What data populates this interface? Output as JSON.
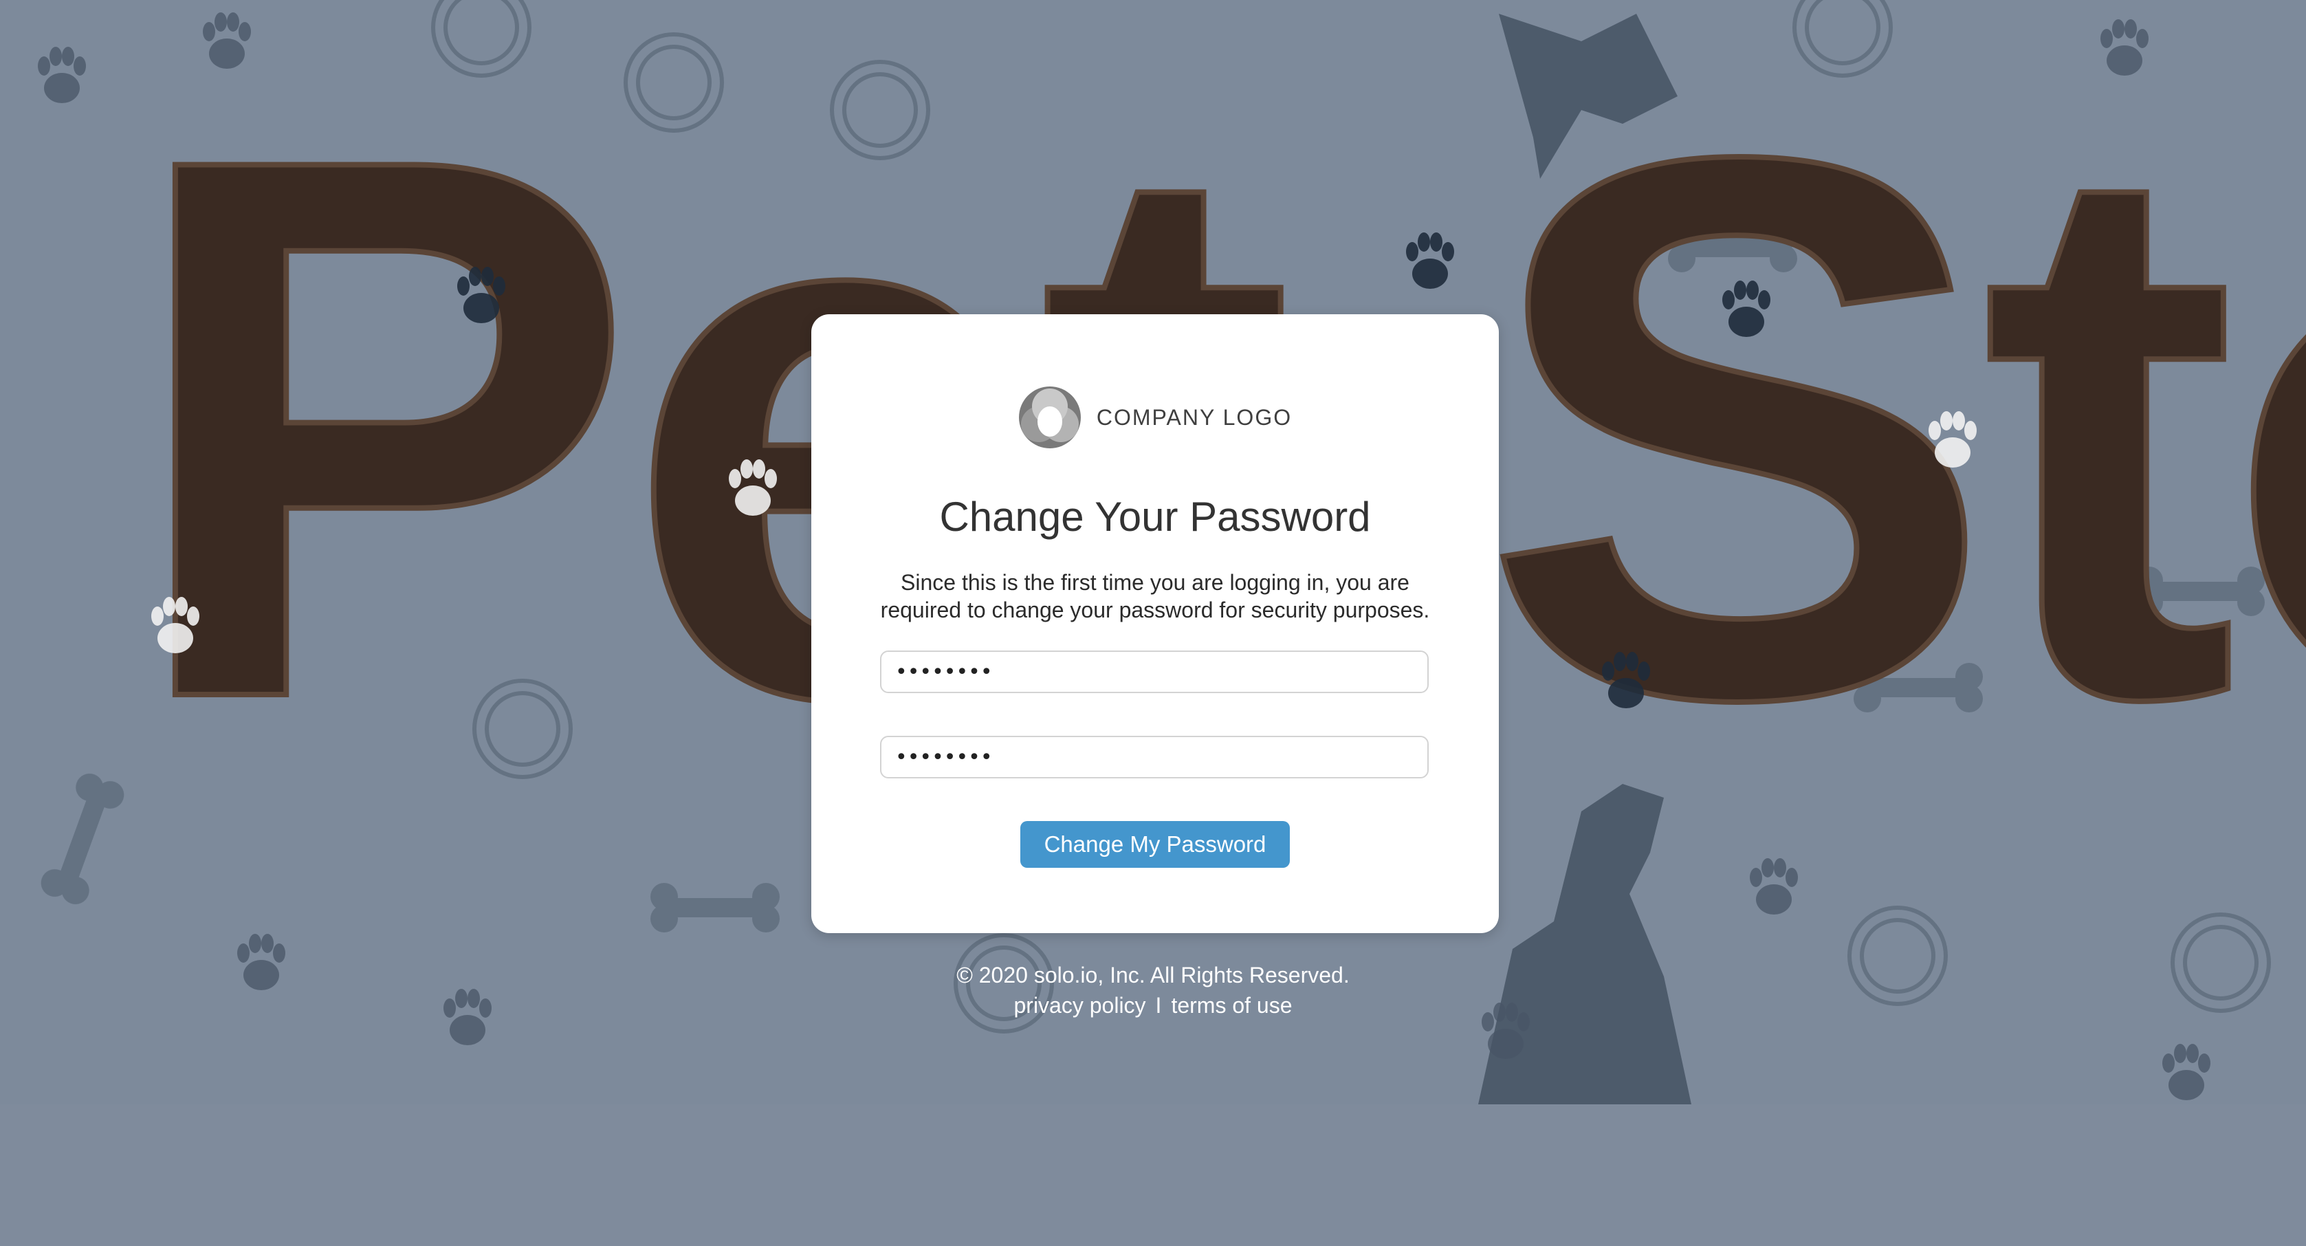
{
  "background": {
    "brand_text": "Pet Store",
    "color": "#7d8a9b"
  },
  "card": {
    "logo_text": "COMPANY LOGO",
    "logo_icon": "company-logo-icon",
    "title": "Change Your Password",
    "description": "Since this is the first time you are logging in, you are required to change your password for security purposes.",
    "new_password": {
      "value": "password"
    },
    "confirm_password": {
      "value": "password"
    },
    "submit_label": "Change My Password",
    "accent_color": "#4496cd"
  },
  "footer": {
    "copyright": "© 2020 solo.io, Inc. All Rights Reserved.",
    "privacy_link": "privacy policy",
    "separator": "I",
    "terms_link": "terms of use"
  }
}
